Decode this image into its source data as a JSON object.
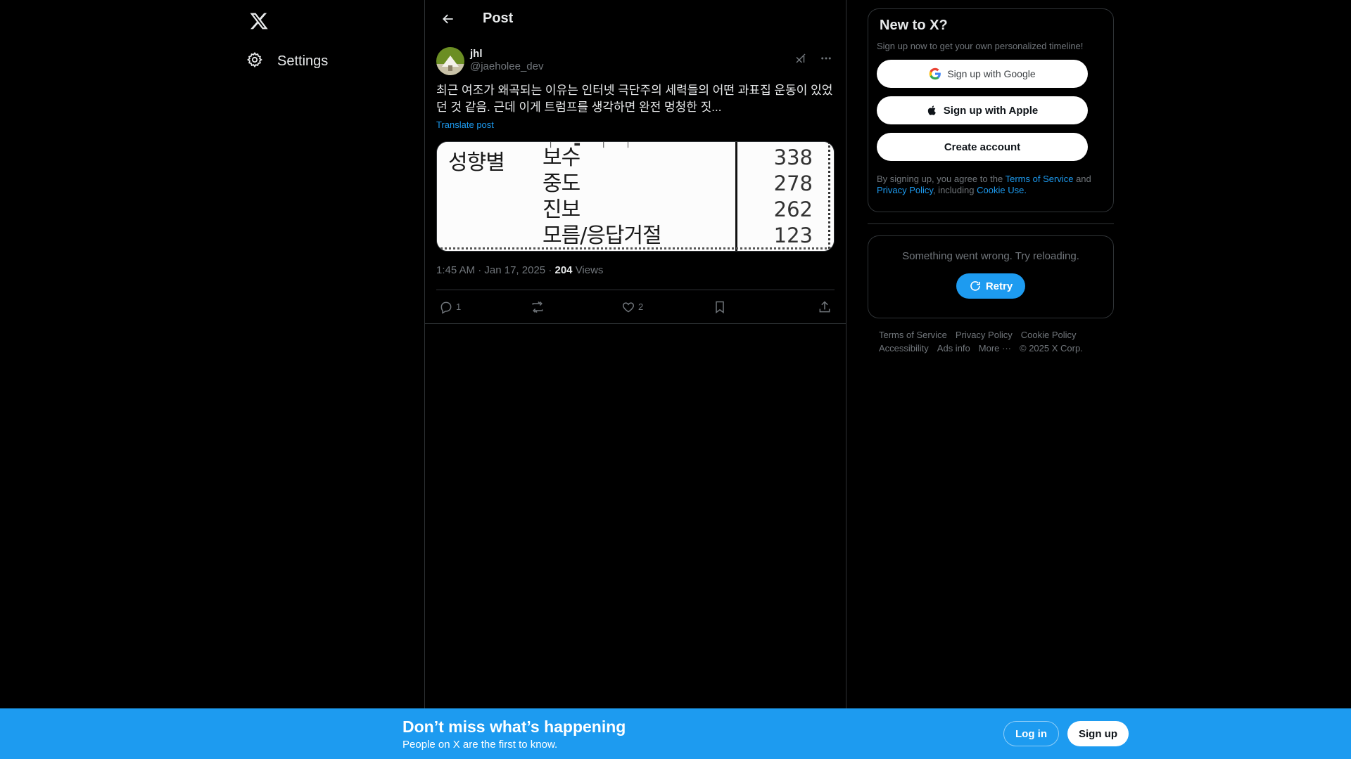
{
  "nav": {
    "logo": "x-logo",
    "settings_label": "Settings"
  },
  "header": {
    "title": "Post"
  },
  "tweet": {
    "author_name": "jhl",
    "author_handle": "@jaeholee_dev",
    "text": "최근 여조가 왜곡되는 이유는 인터넷 극단주의 세력들의 어떤 과표집 운동이 있었던 것 같음. 근데 이게 트럼프를 생각하면 완전 멍청한 짓...",
    "translate_label": "Translate post",
    "media": {
      "column_label": "성향별",
      "rows": [
        {
          "label": "보수",
          "value": "338"
        },
        {
          "label": "중도",
          "value": "278"
        },
        {
          "label": "진보",
          "value": "262"
        },
        {
          "label": "모름/응답거절",
          "value": "123"
        }
      ]
    },
    "time": "1:45 AM",
    "date": "Jan 17, 2025",
    "views_count": "204",
    "views_label": "Views",
    "replies": "1",
    "likes": "2"
  },
  "signup": {
    "title": "New to X?",
    "subtitle": "Sign up now to get your own personalized timeline!",
    "google_label": "Sign up with Google",
    "apple_label": "Sign up with Apple",
    "create_label": "Create account",
    "legal_prefix": "By signing up, you agree to the",
    "terms_label": "Terms of Service",
    "and_label": "and",
    "privacy_label": "Privacy Policy",
    "including_label": ", including",
    "cookie_label": "Cookie Use."
  },
  "error": {
    "message": "Something went wrong. Try reloading.",
    "retry_label": "Retry"
  },
  "footer": {
    "links": [
      "Terms of Service",
      "Privacy Policy",
      "Cookie Policy",
      "Accessibility",
      "Ads info",
      "More ···",
      "© 2025 X Corp."
    ]
  },
  "banner": {
    "title": "Don’t miss what’s happening",
    "subtitle": "People on X are the first to know.",
    "login_label": "Log in",
    "signup_label": "Sign up"
  },
  "colors": {
    "accent": "#1d9bf0",
    "background": "#000000",
    "border": "#2f3336",
    "secondary_text": "#71767b"
  }
}
